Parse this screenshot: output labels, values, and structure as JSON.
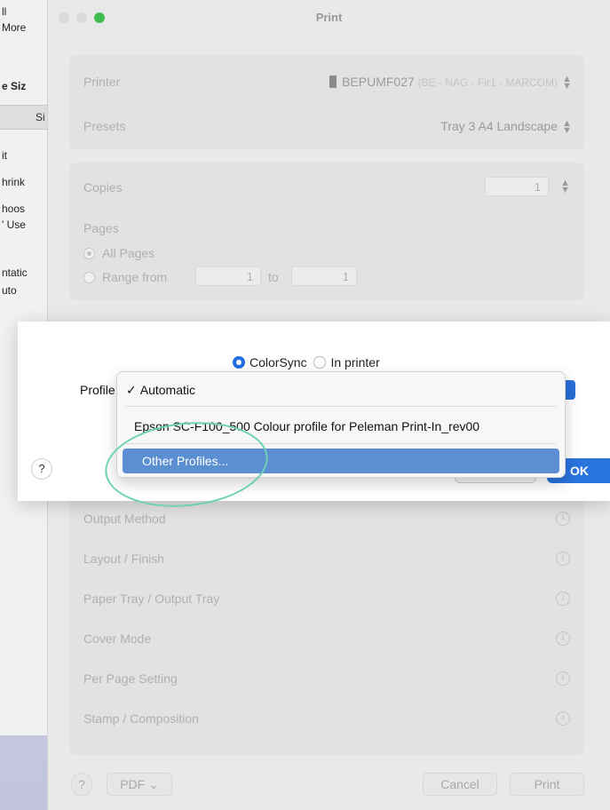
{
  "background_window": {
    "fragments": [
      "ll",
      "More",
      "e Siz",
      "Si",
      "it",
      "hrink",
      "hoos",
      "' Use",
      "ntatic",
      "uto"
    ]
  },
  "print_dialog": {
    "title": "Print",
    "printer": {
      "label": "Printer",
      "value": "BEPUMF027",
      "detail": "(BE - NAG - Flr1 - MARCOM)"
    },
    "presets": {
      "label": "Presets",
      "value": "Tray 3 A4 Landscape"
    },
    "copies": {
      "label": "Copies",
      "value": "1"
    },
    "pages": {
      "label": "Pages",
      "all_pages": "All Pages",
      "range_from": "Range from",
      "range_to": "to",
      "from_value": "1",
      "to_value": "1"
    },
    "sections": [
      "Output Method",
      "Layout / Finish",
      "Paper Tray / Output Tray",
      "Cover Mode",
      "Per Page Setting",
      "Stamp / Composition"
    ],
    "info_glyph": "i",
    "footer": {
      "help": "?",
      "pdf": "PDF",
      "pdf_chevron": "⌄",
      "cancel": "Cancel",
      "print": "Print"
    }
  },
  "colorsync_dialog": {
    "mode_colorsync": "ColorSync",
    "mode_in_printer": "In printer",
    "profile_label": "Profile",
    "help": "?",
    "ok": "OK",
    "accent_color": "#2a74de"
  },
  "profile_menu": {
    "check": "✓",
    "items": [
      "Automatic",
      "Epson SC-F100_500 Colour profile for Peleman Print-In_rev00",
      "Other Profiles..."
    ],
    "highlight_color": "#5b8fd2"
  },
  "annotation": {
    "ring_color": "#6ed0b6"
  }
}
